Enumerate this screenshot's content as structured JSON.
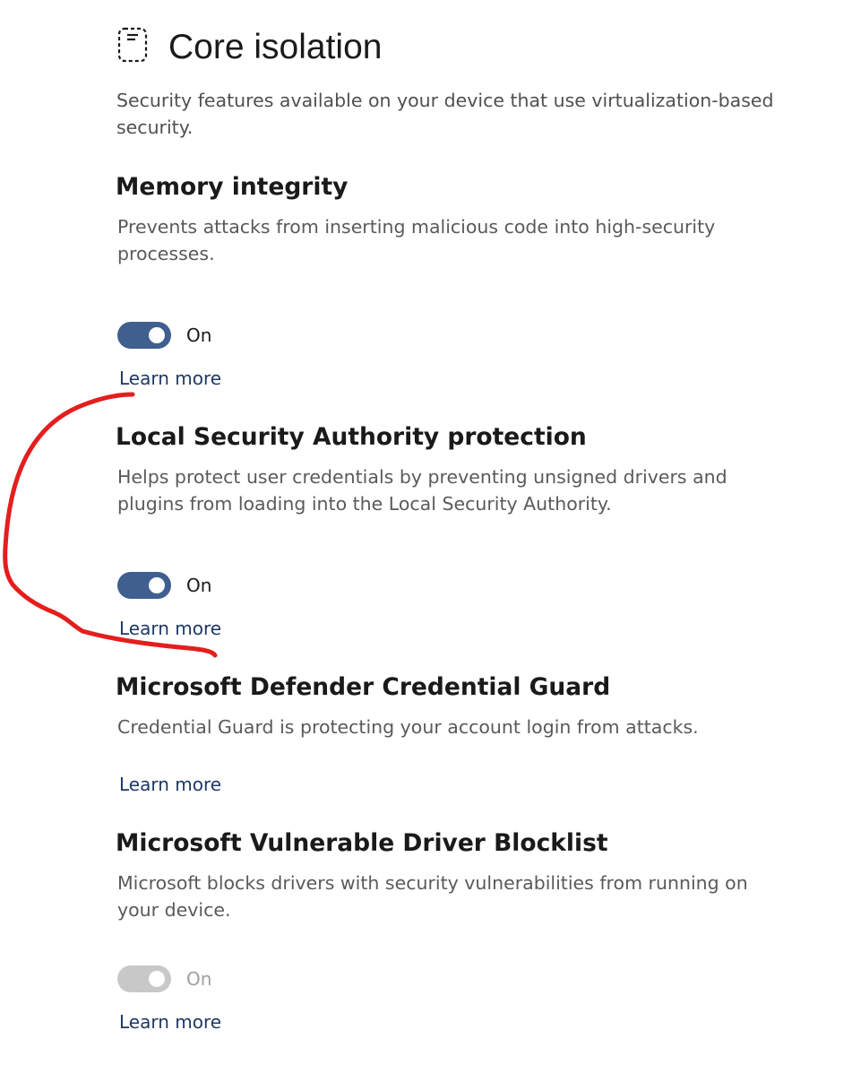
{
  "header": {
    "icon": "core-isolation-chip-icon",
    "title": "Core isolation",
    "description": "Security features available on your device that use virtualization-based security."
  },
  "sections": [
    {
      "heading": "Memory integrity",
      "description": "Prevents attacks from inserting malicious code into high-security processes.",
      "toggle_state": "On",
      "toggle_on": true,
      "toggle_enabled": true,
      "link": "Learn more"
    },
    {
      "heading": "Local Security Authority protection",
      "description": "Helps protect user credentials by preventing unsigned drivers and plugins from loading into the Local Security Authority.",
      "toggle_state": "On",
      "toggle_on": true,
      "toggle_enabled": true,
      "link": "Learn more"
    },
    {
      "heading": "Microsoft Defender Credential Guard",
      "description": "Credential Guard is protecting your account login from attacks.",
      "link": "Learn more"
    },
    {
      "heading": "Microsoft Vulnerable Driver Blocklist",
      "description": "Microsoft blocks drivers with security vulnerabilities from running on your device.",
      "toggle_state": "On",
      "toggle_on": true,
      "toggle_enabled": false,
      "link": "Learn more"
    }
  ],
  "colors": {
    "toggle_on": "#3f5f8f",
    "toggle_disabled": "#c8c8c8",
    "link": "#1f3864",
    "annotation_stroke": "#e41e1e"
  }
}
